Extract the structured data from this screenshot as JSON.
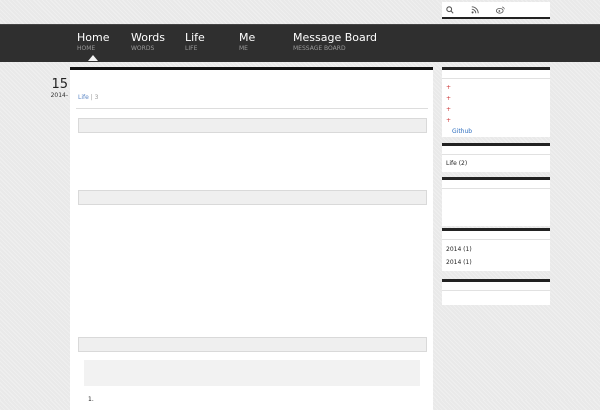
{
  "site": {
    "title": ""
  },
  "top_tools": {
    "search_label": "",
    "rss_label": "",
    "weibo_label": ""
  },
  "nav": [
    {
      "label": "Home",
      "sub": "HOME"
    },
    {
      "label": "Words",
      "sub": "WORDS"
    },
    {
      "label": "Life",
      "sub": "LIFE"
    },
    {
      "label": "Me",
      "sub": "ME"
    },
    {
      "label": "Message Board",
      "sub": "MESSAGE BOARD"
    }
  ],
  "post": {
    "day": "15",
    "year": "2014-",
    "title": "",
    "meta_prefix": "",
    "meta_category": "Life",
    "meta_sep": " | ",
    "meta_comments": "3",
    "sections": [
      {
        "heading": "",
        "lines": [
          "",
          "",
          ""
        ]
      },
      {
        "heading": "",
        "lines": [
          "",
          "",
          "",
          "",
          "",
          "",
          ""
        ]
      },
      {
        "heading": "",
        "quote": "",
        "after": "1."
      }
    ]
  },
  "sidebar": {
    "w1": {
      "title": "",
      "items": [
        "",
        "",
        "",
        ""
      ],
      "github_label": "Github",
      "extra_label": ""
    },
    "w2": {
      "title": "",
      "items": [
        "Life (2)"
      ]
    },
    "w3": {
      "title": "",
      "items": [
        "",
        ""
      ]
    },
    "w4": {
      "title": "",
      "items": [
        "2014 (1)",
        "2014 (1)"
      ]
    },
    "w5": {
      "title": "",
      "items": []
    }
  },
  "colors": {
    "nav_bg": "#2f2f2f",
    "accent": "#111111",
    "link": "#2f6fbf",
    "plus": "#cc3333"
  }
}
